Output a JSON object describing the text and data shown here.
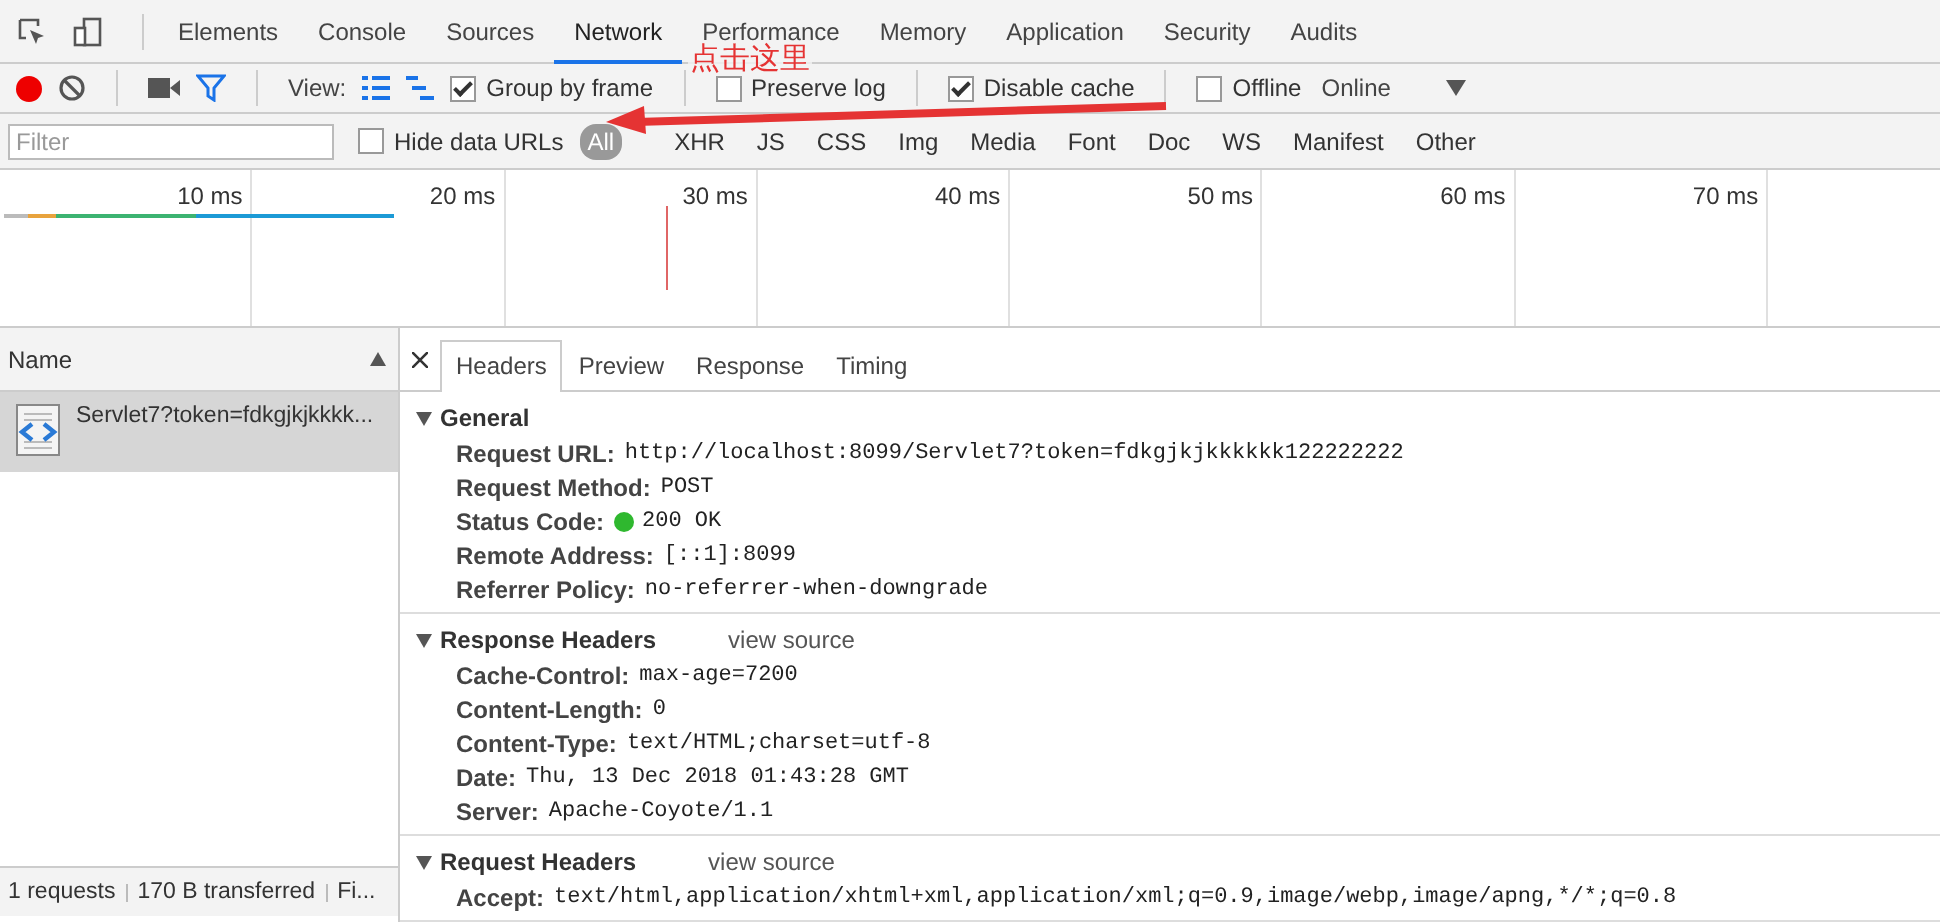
{
  "tabs": [
    {
      "label": "Elements",
      "selected": false
    },
    {
      "label": "Console",
      "selected": false
    },
    {
      "label": "Sources",
      "selected": false
    },
    {
      "label": "Network",
      "selected": true
    },
    {
      "label": "Performance",
      "selected": false
    },
    {
      "label": "Memory",
      "selected": false
    },
    {
      "label": "Application",
      "selected": false
    },
    {
      "label": "Security",
      "selected": false
    },
    {
      "label": "Audits",
      "selected": false
    }
  ],
  "toolbar": {
    "recording": true,
    "view_label": "View:",
    "options": [
      {
        "label": "Group by frame",
        "checked": true
      },
      {
        "label": "Preserve log",
        "checked": false
      },
      {
        "label": "Disable cache",
        "checked": true
      },
      {
        "label": "Offline",
        "checked": false
      }
    ],
    "throttling": "Online"
  },
  "filter": {
    "placeholder": "Filter",
    "hide_data_urls": {
      "label": "Hide data URLs",
      "checked": false
    },
    "types": [
      {
        "label": "All",
        "selected": true
      },
      {
        "label": "XHR",
        "selected": false
      },
      {
        "label": "JS",
        "selected": false
      },
      {
        "label": "CSS",
        "selected": false
      },
      {
        "label": "Img",
        "selected": false
      },
      {
        "label": "Media",
        "selected": false
      },
      {
        "label": "Font",
        "selected": false
      },
      {
        "label": "Doc",
        "selected": false
      },
      {
        "label": "WS",
        "selected": false
      },
      {
        "label": "Manifest",
        "selected": false
      },
      {
        "label": "Other",
        "selected": false
      }
    ]
  },
  "timeline": {
    "ticks": [
      "10 ms",
      "20 ms",
      "30 ms",
      "40 ms",
      "50 ms",
      "60 ms",
      "70 ms"
    ]
  },
  "requests": {
    "column": "Name",
    "rows": [
      {
        "name": "Servlet7?token=fdkgjkjkkkk...",
        "selected": true
      }
    ]
  },
  "detail": {
    "tabs": [
      {
        "label": "Headers",
        "selected": true
      },
      {
        "label": "Preview",
        "selected": false
      },
      {
        "label": "Response",
        "selected": false
      },
      {
        "label": "Timing",
        "selected": false
      }
    ],
    "sections": [
      {
        "title": "General",
        "expanded": true,
        "rows": [
          {
            "key": "Request URL:",
            "value": "http://localhost:8099/Servlet7?token=fdkgjkjkkkkkk122222222"
          },
          {
            "key": "Request Method:",
            "value": "POST"
          },
          {
            "key": "Status Code:",
            "value": "200 OK",
            "color": "#2fb82f"
          },
          {
            "key": "Remote Address:",
            "value": "[::1]:8099"
          },
          {
            "key": "Referrer Policy:",
            "value": "no-referrer-when-downgrade"
          }
        ]
      },
      {
        "title": "Response Headers",
        "link": "view source",
        "expanded": true,
        "rows": [
          {
            "key": "Cache-Control:",
            "value": "max-age=7200"
          },
          {
            "key": "Content-Length:",
            "value": "0"
          },
          {
            "key": "Content-Type:",
            "value": "text/HTML;charset=utf-8"
          },
          {
            "key": "Date:",
            "value": "Thu, 13 Dec 2018 01:43:28 GMT"
          },
          {
            "key": "Server:",
            "value": "Apache-Coyote/1.1"
          }
        ]
      },
      {
        "title": "Request Headers",
        "link": "view source",
        "expanded": true,
        "rows": [
          {
            "key": "Accept:",
            "value": "text/html,application/xhtml+xml,application/xml;q=0.9,image/webp,image/apng,*/*;q=0.8"
          }
        ]
      }
    ]
  },
  "status_bar": [
    "1 requests",
    "170 B transferred",
    "Fi..."
  ],
  "annotation": {
    "text": "点击这里"
  }
}
